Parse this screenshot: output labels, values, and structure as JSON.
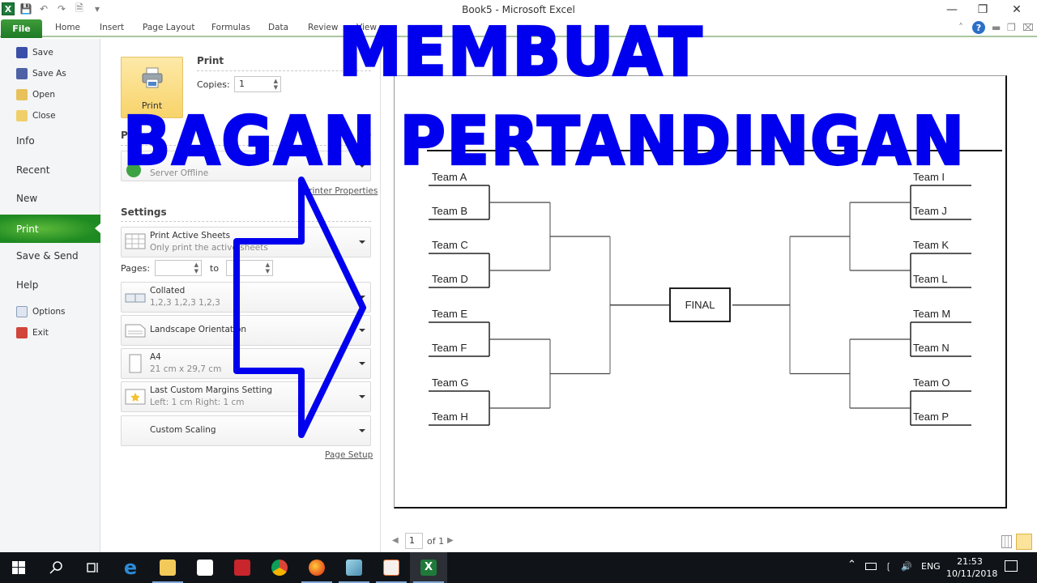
{
  "window": {
    "title": "Book5  -  Microsoft Excel",
    "controls": [
      "minimize",
      "restore",
      "close"
    ]
  },
  "ribbon": {
    "file_tab": "File",
    "tabs": [
      "Home",
      "Insert",
      "Page Layout",
      "Formulas",
      "Data",
      "Review",
      "View"
    ],
    "help_label": "?"
  },
  "backstage": {
    "top_items": [
      {
        "label": "Save",
        "icon": "save-icon"
      },
      {
        "label": "Save As",
        "icon": "save-as-icon"
      },
      {
        "label": "Open",
        "icon": "open-folder-icon"
      },
      {
        "label": "Close",
        "icon": "close-folder-icon"
      }
    ],
    "sections": [
      "Info",
      "Recent",
      "New",
      "Print",
      "Save & Send",
      "Help"
    ],
    "selected": "Print",
    "bottom_items": [
      {
        "label": "Options",
        "icon": "options-icon"
      },
      {
        "label": "Exit",
        "icon": "exit-icon"
      }
    ]
  },
  "print_pane": {
    "print_button": "Print",
    "heading": "Print",
    "copies_label": "Copies:",
    "copies_value": "1",
    "printer_heading": "P",
    "printer_status": "Server Offline",
    "printer_properties_link": "Printer Properties",
    "settings_heading": "Settings",
    "what_to_print": {
      "title": "Print Active Sheets",
      "subtitle": "Only print the active sheets"
    },
    "pages_label": "Pages:",
    "pages_from": "",
    "pages_to_label": "to",
    "pages_to": "",
    "collation": {
      "title": "Collated",
      "subtitle": "1,2,3    1,2,3    1,2,3"
    },
    "orientation": {
      "title": "Landscape Orientation"
    },
    "paper": {
      "title": "A4",
      "subtitle": "21 cm x 29,7 cm"
    },
    "margins": {
      "title": "Last Custom Margins Setting",
      "subtitle": "Left:  1 cm    Right:  1 cm"
    },
    "scaling": {
      "title": "Custom Scaling"
    },
    "page_setup_link": "Page Setup"
  },
  "preview": {
    "left_teams": [
      "Team A",
      "Team B",
      "Team C",
      "Team D",
      "Team E",
      "Team F",
      "Team G",
      "Team H"
    ],
    "right_teams": [
      "Team I",
      "Team J",
      "Team K",
      "Team L",
      "Team M",
      "Team N",
      "Team O",
      "Team P"
    ],
    "final_label": "FINAL",
    "current_page": "1",
    "page_total": "of 1"
  },
  "overlay": {
    "line1": "MEMBUAT",
    "line2": "BAGAN PERTANDINGAN",
    "color": "#0000ee"
  },
  "taskbar": {
    "apps": [
      "start",
      "search",
      "task-view",
      "edge",
      "file-explorer",
      "store",
      "gift-app",
      "chrome",
      "firefox",
      "notepad-app",
      "office-app",
      "excel"
    ],
    "language": "ENG",
    "time": "21:53",
    "date": "10/11/2018"
  }
}
